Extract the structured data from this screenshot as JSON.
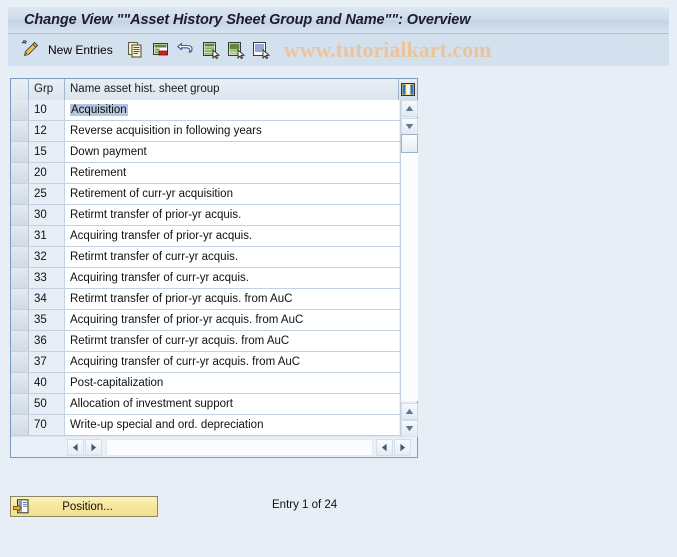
{
  "window": {
    "title": "Change View \"\"Asset History Sheet Group and Name\"\": Overview"
  },
  "toolbar": {
    "pencil_icon": "pencil-edit-icon",
    "new_entries_label": "New Entries",
    "icons": [
      {
        "name": "copy-icon"
      },
      {
        "name": "delete-row-icon"
      },
      {
        "name": "undo-icon"
      },
      {
        "name": "select-all-icon"
      },
      {
        "name": "deselect-all-icon"
      },
      {
        "name": "details-icon"
      }
    ],
    "watermark": "www.tutorialkart.com"
  },
  "table": {
    "columns": [
      {
        "key": "sel",
        "label": ""
      },
      {
        "key": "grp",
        "label": "Grp"
      },
      {
        "key": "name",
        "label": "Name asset hist. sheet group"
      }
    ],
    "config_icon": "table-settings-icon",
    "selected_row_index": 0,
    "rows": [
      {
        "grp": "10",
        "name": "Acquisition"
      },
      {
        "grp": "12",
        "name": "Reverse acquisition in following years"
      },
      {
        "grp": "15",
        "name": "Down payment"
      },
      {
        "grp": "20",
        "name": "Retirement"
      },
      {
        "grp": "25",
        "name": "Retirement of curr-yr acquisition"
      },
      {
        "grp": "30",
        "name": "Retirmt transfer of prior-yr acquis."
      },
      {
        "grp": "31",
        "name": "Acquiring transfer of prior-yr acquis."
      },
      {
        "grp": "32",
        "name": "Retirmt transfer of curr-yr acquis."
      },
      {
        "grp": "33",
        "name": "Acquiring transfer of curr-yr acquis."
      },
      {
        "grp": "34",
        "name": "Retirmt transfer of prior-yr acquis. from AuC"
      },
      {
        "grp": "35",
        "name": "Acquiring transfer of prior-yr acquis. from AuC"
      },
      {
        "grp": "36",
        "name": "Retirmt transfer of curr-yr acquis. from AuC"
      },
      {
        "grp": "37",
        "name": "Acquiring transfer of curr-yr acquis. from AuC"
      },
      {
        "grp": "40",
        "name": "Post-capitalization"
      },
      {
        "grp": "50",
        "name": "Allocation of investment support"
      },
      {
        "grp": "70",
        "name": "Write-up special and ord. depreciation"
      }
    ]
  },
  "scrollbars": {
    "vertical_up_icon": "scroll-up-arrow-icon",
    "vertical_down_icon": "scroll-down-arrow-icon",
    "horizontal_left_icon": "scroll-left-arrow-icon",
    "horizontal_right_icon": "scroll-right-arrow-icon"
  },
  "footer": {
    "position_button_label": "Position...",
    "position_button_icon": "position-jump-icon",
    "entry_status": "Entry 1 of 24"
  },
  "colors": {
    "background": "#e8eef5",
    "titlebar": "#cfdcec",
    "toolbar": "#d3e0ee",
    "panel_border": "#7a9cc0",
    "selection": "#b3c6de",
    "watermark": "#edc49a",
    "button_yellow": "#f6e79c"
  }
}
